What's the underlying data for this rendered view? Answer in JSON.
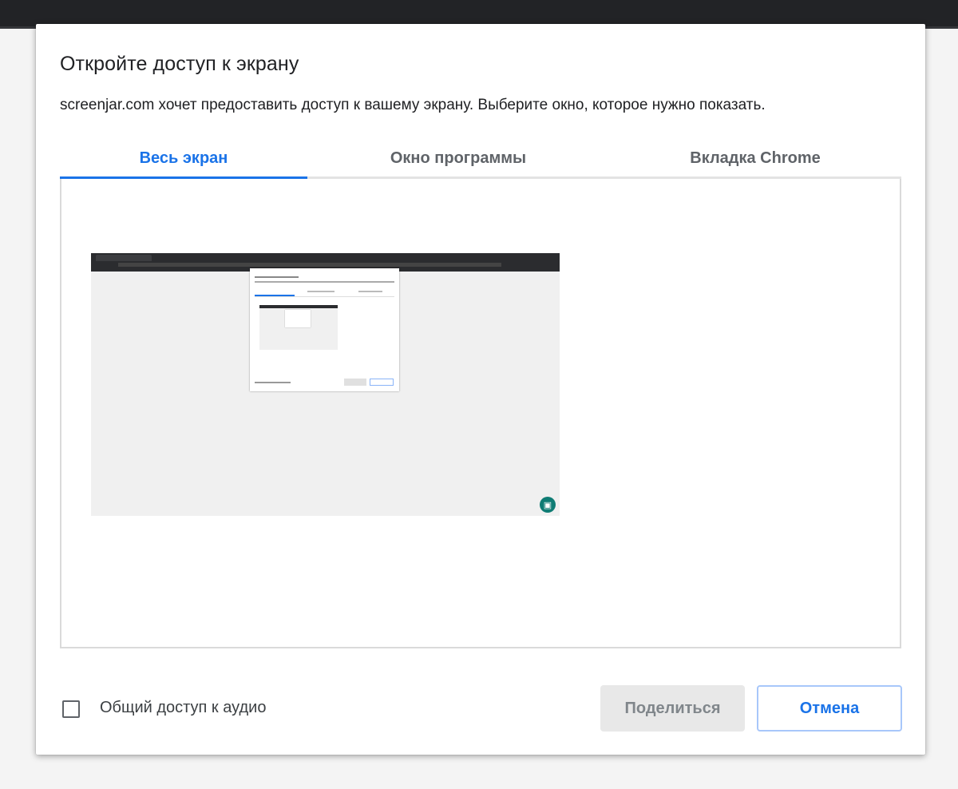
{
  "dialog": {
    "title": "Откройте доступ к экрану",
    "subtitle": "screenjar.com хочет предоставить доступ к вашему экрану. Выберите окно, которое нужно показать."
  },
  "tabs": [
    {
      "label": "Весь экран",
      "selected": true
    },
    {
      "label": "Окно программы",
      "selected": false
    },
    {
      "label": "Вкладка Chrome",
      "selected": false
    }
  ],
  "footer": {
    "audio_checkbox_label": "Общий доступ к аудио",
    "audio_checked": false,
    "share_label": "Поделиться",
    "cancel_label": "Отмена"
  },
  "colors": {
    "accent": "#1a73e8",
    "title_text": "#202124",
    "tab_inactive": "#5f6368",
    "share_disabled_bg": "#e8e8e8"
  },
  "icons": {
    "thumbnail_badge": "screen-share-badge-icon"
  }
}
